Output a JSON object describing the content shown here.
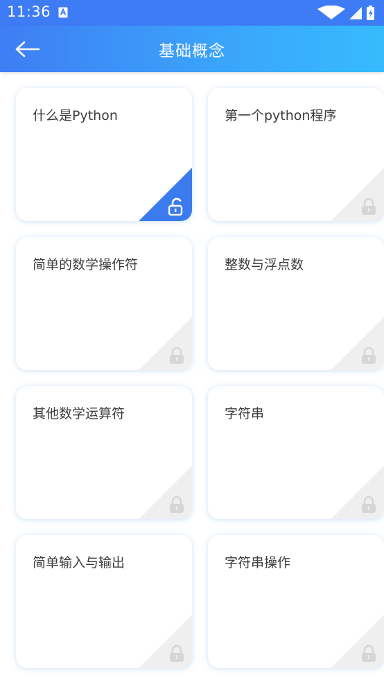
{
  "status": {
    "time": "11:36"
  },
  "header": {
    "title": "基础概念"
  },
  "lessons": [
    {
      "title": "什么是Python",
      "locked": false
    },
    {
      "title": "第一个python程序",
      "locked": true
    },
    {
      "title": "简单的数学操作符",
      "locked": true
    },
    {
      "title": "整数与浮点数",
      "locked": true
    },
    {
      "title": "其他数学运算符",
      "locked": true
    },
    {
      "title": "字符串",
      "locked": true
    },
    {
      "title": "简单输入与输出",
      "locked": true
    },
    {
      "title": "字符串操作",
      "locked": true
    }
  ],
  "colors": {
    "accent": "#3b7bee",
    "locked_corner": "#efefef",
    "locked_icon": "#d6d6d6"
  }
}
